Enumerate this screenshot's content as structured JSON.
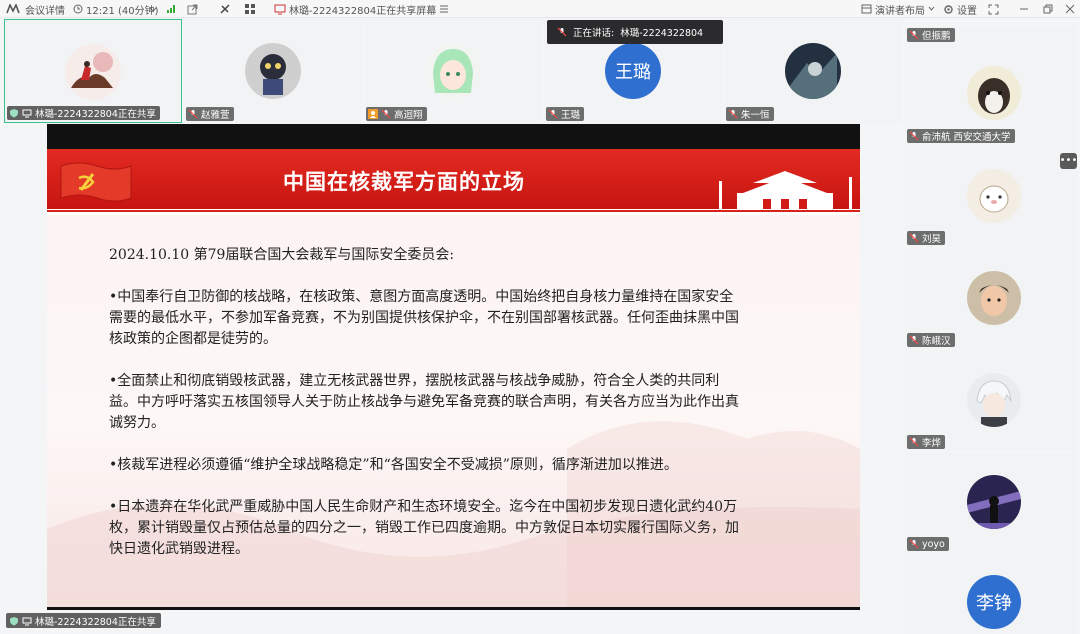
{
  "topbar": {
    "meeting_info": "会议详情",
    "time": "12:21 (40分钟)",
    "share_title": "林璐-2224322804正在共享屏幕",
    "layout": "演讲者布局",
    "settings": "设置"
  },
  "speaking": {
    "prefix": "正在讲话:",
    "name": "林璐-2224322804"
  },
  "top_tiles": [
    {
      "name": "林璐-2224322804正在共享"
    },
    {
      "name": "赵雅萱"
    },
    {
      "name": "高迴翔"
    },
    {
      "name": "王璐",
      "avatar_text": "王璐"
    },
    {
      "name": "朱一恒"
    }
  ],
  "side_tiles": [
    {
      "name": "但振鹏"
    },
    {
      "name": "俞沛航 西安交通大学"
    },
    {
      "name": "刘昊"
    },
    {
      "name": "陈峨汉"
    },
    {
      "name": "李烨"
    },
    {
      "name": "yoyo"
    },
    {
      "name": "李铮",
      "avatar_text": "李铮"
    }
  ],
  "slide": {
    "title": "中国在核裁军方面的立场",
    "paragraphs": [
      "2024.10.10 第79届联合国大会裁军与国际安全委员会:",
      "•中国奉行自卫防御的核战略，在核政策、意图方面高度透明。中国始终把自身核力量维持在国家安全需要的最低水平，不参加军备竞赛，不为别国提供核保护伞，不在别国部署核武器。任何歪曲抹黑中国核政策的企图都是徒劳的。",
      "•全面禁止和彻底销毁核武器，建立无核武器世界，摆脱核武器与核战争威胁，符合全人类的共同利益。中方呼吁落实五核国领导人关于防止核战争与避免军备竞赛的联合声明，有关各方应当为此作出真诚努力。",
      "•核裁军进程必须遵循“维护全球战略稳定”和“各国安全不受减损”原则，循序渐进加以推进。",
      "•日本遗弃在华化武严重威胁中国人民生命财产和生态环境安全。迄今在中国初步发现日遗化武约40万枚，累计销毁量仅占预估总量的四分之一，销毁工作已四度逾期。中方敦促日本切实履行国际义务，加快日遗化武销毁进程。"
    ]
  },
  "bottom_tag": "林璐-2224322804正在共享",
  "colors": {
    "slide_red": "#d11a16",
    "avatar_blue": "#2f6fd0"
  }
}
